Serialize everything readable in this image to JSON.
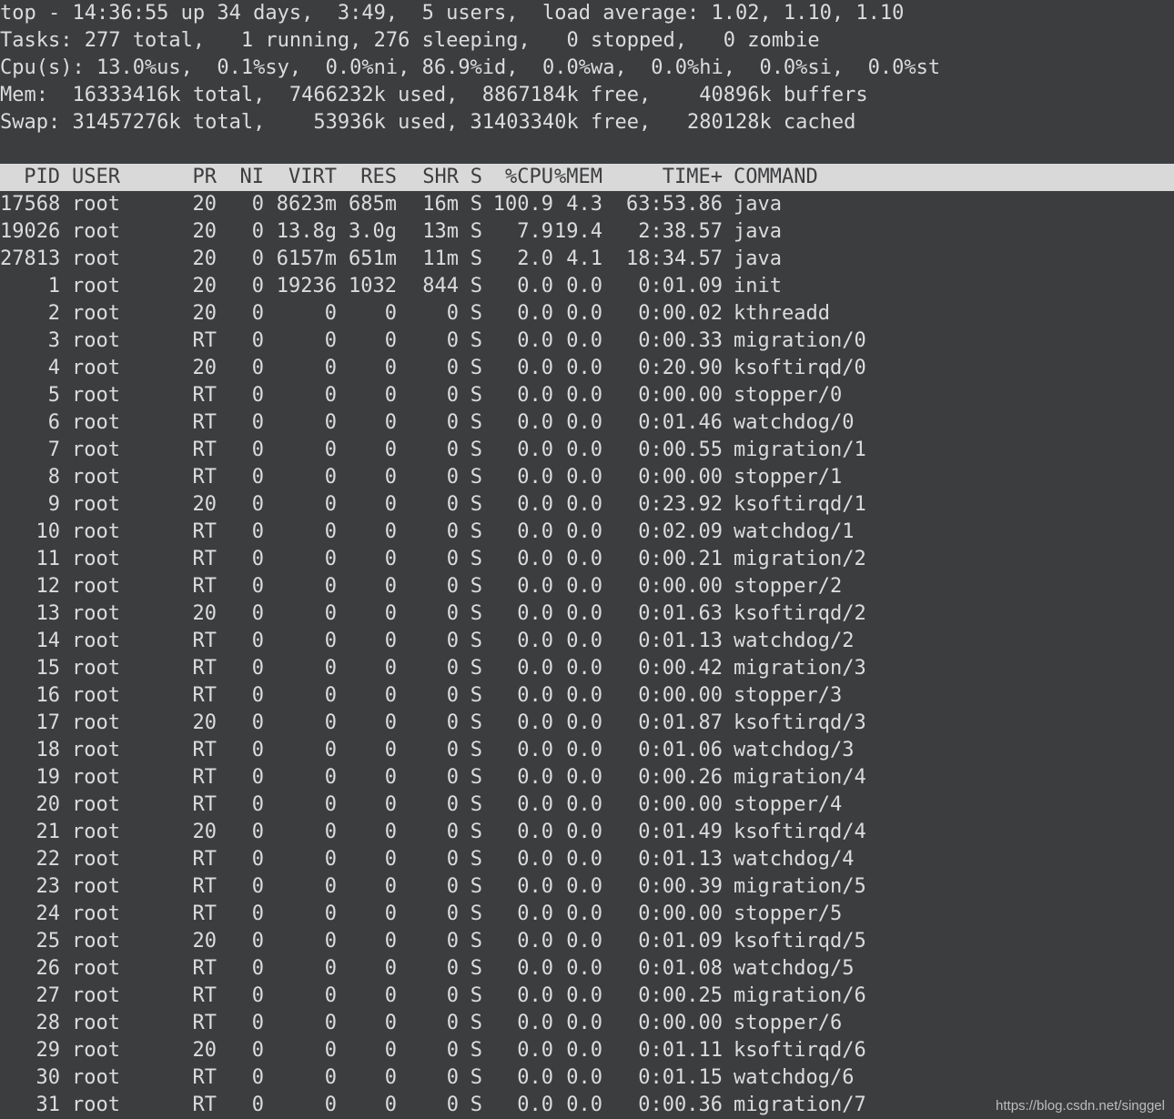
{
  "summary": {
    "line1": "top - 14:36:55 up 34 days,  3:49,  5 users,  load average: 1.02, 1.10, 1.10",
    "line2": "Tasks: 277 total,   1 running, 276 sleeping,   0 stopped,   0 zombie",
    "line3": "Cpu(s): 13.0%us,  0.1%sy,  0.0%ni, 86.9%id,  0.0%wa,  0.0%hi,  0.0%si,  0.0%st",
    "line4": "Mem:  16333416k total,  7466232k used,  8867184k free,    40896k buffers",
    "line5": "Swap: 31457276k total,    53936k used, 31403340k free,   280128k cached"
  },
  "columns": {
    "pid": "PID",
    "user": "USER",
    "pr": "PR",
    "ni": "NI",
    "virt": "VIRT",
    "res": "RES",
    "shr": "SHR",
    "s": "S",
    "cpu": "%CPU",
    "mem": "%MEM",
    "time": "TIME+",
    "command": "COMMAND"
  },
  "processes": [
    {
      "pid": "17568",
      "user": "root",
      "pr": "20",
      "ni": "0",
      "virt": "8623m",
      "res": "685m",
      "shr": "16m",
      "s": "S",
      "cpu": "100.9",
      "mem": "4.3",
      "time": "63:53.86",
      "command": "java"
    },
    {
      "pid": "19026",
      "user": "root",
      "pr": "20",
      "ni": "0",
      "virt": "13.8g",
      "res": "3.0g",
      "shr": "13m",
      "s": "S",
      "cpu": "7.9",
      "mem": "19.4",
      "time": "2:38.57",
      "command": "java"
    },
    {
      "pid": "27813",
      "user": "root",
      "pr": "20",
      "ni": "0",
      "virt": "6157m",
      "res": "651m",
      "shr": "11m",
      "s": "S",
      "cpu": "2.0",
      "mem": "4.1",
      "time": "18:34.57",
      "command": "java"
    },
    {
      "pid": "1",
      "user": "root",
      "pr": "20",
      "ni": "0",
      "virt": "19236",
      "res": "1032",
      "shr": "844",
      "s": "S",
      "cpu": "0.0",
      "mem": "0.0",
      "time": "0:01.09",
      "command": "init"
    },
    {
      "pid": "2",
      "user": "root",
      "pr": "20",
      "ni": "0",
      "virt": "0",
      "res": "0",
      "shr": "0",
      "s": "S",
      "cpu": "0.0",
      "mem": "0.0",
      "time": "0:00.02",
      "command": "kthreadd"
    },
    {
      "pid": "3",
      "user": "root",
      "pr": "RT",
      "ni": "0",
      "virt": "0",
      "res": "0",
      "shr": "0",
      "s": "S",
      "cpu": "0.0",
      "mem": "0.0",
      "time": "0:00.33",
      "command": "migration/0"
    },
    {
      "pid": "4",
      "user": "root",
      "pr": "20",
      "ni": "0",
      "virt": "0",
      "res": "0",
      "shr": "0",
      "s": "S",
      "cpu": "0.0",
      "mem": "0.0",
      "time": "0:20.90",
      "command": "ksoftirqd/0"
    },
    {
      "pid": "5",
      "user": "root",
      "pr": "RT",
      "ni": "0",
      "virt": "0",
      "res": "0",
      "shr": "0",
      "s": "S",
      "cpu": "0.0",
      "mem": "0.0",
      "time": "0:00.00",
      "command": "stopper/0"
    },
    {
      "pid": "6",
      "user": "root",
      "pr": "RT",
      "ni": "0",
      "virt": "0",
      "res": "0",
      "shr": "0",
      "s": "S",
      "cpu": "0.0",
      "mem": "0.0",
      "time": "0:01.46",
      "command": "watchdog/0"
    },
    {
      "pid": "7",
      "user": "root",
      "pr": "RT",
      "ni": "0",
      "virt": "0",
      "res": "0",
      "shr": "0",
      "s": "S",
      "cpu": "0.0",
      "mem": "0.0",
      "time": "0:00.55",
      "command": "migration/1"
    },
    {
      "pid": "8",
      "user": "root",
      "pr": "RT",
      "ni": "0",
      "virt": "0",
      "res": "0",
      "shr": "0",
      "s": "S",
      "cpu": "0.0",
      "mem": "0.0",
      "time": "0:00.00",
      "command": "stopper/1"
    },
    {
      "pid": "9",
      "user": "root",
      "pr": "20",
      "ni": "0",
      "virt": "0",
      "res": "0",
      "shr": "0",
      "s": "S",
      "cpu": "0.0",
      "mem": "0.0",
      "time": "0:23.92",
      "command": "ksoftirqd/1"
    },
    {
      "pid": "10",
      "user": "root",
      "pr": "RT",
      "ni": "0",
      "virt": "0",
      "res": "0",
      "shr": "0",
      "s": "S",
      "cpu": "0.0",
      "mem": "0.0",
      "time": "0:02.09",
      "command": "watchdog/1"
    },
    {
      "pid": "11",
      "user": "root",
      "pr": "RT",
      "ni": "0",
      "virt": "0",
      "res": "0",
      "shr": "0",
      "s": "S",
      "cpu": "0.0",
      "mem": "0.0",
      "time": "0:00.21",
      "command": "migration/2"
    },
    {
      "pid": "12",
      "user": "root",
      "pr": "RT",
      "ni": "0",
      "virt": "0",
      "res": "0",
      "shr": "0",
      "s": "S",
      "cpu": "0.0",
      "mem": "0.0",
      "time": "0:00.00",
      "command": "stopper/2"
    },
    {
      "pid": "13",
      "user": "root",
      "pr": "20",
      "ni": "0",
      "virt": "0",
      "res": "0",
      "shr": "0",
      "s": "S",
      "cpu": "0.0",
      "mem": "0.0",
      "time": "0:01.63",
      "command": "ksoftirqd/2"
    },
    {
      "pid": "14",
      "user": "root",
      "pr": "RT",
      "ni": "0",
      "virt": "0",
      "res": "0",
      "shr": "0",
      "s": "S",
      "cpu": "0.0",
      "mem": "0.0",
      "time": "0:01.13",
      "command": "watchdog/2"
    },
    {
      "pid": "15",
      "user": "root",
      "pr": "RT",
      "ni": "0",
      "virt": "0",
      "res": "0",
      "shr": "0",
      "s": "S",
      "cpu": "0.0",
      "mem": "0.0",
      "time": "0:00.42",
      "command": "migration/3"
    },
    {
      "pid": "16",
      "user": "root",
      "pr": "RT",
      "ni": "0",
      "virt": "0",
      "res": "0",
      "shr": "0",
      "s": "S",
      "cpu": "0.0",
      "mem": "0.0",
      "time": "0:00.00",
      "command": "stopper/3"
    },
    {
      "pid": "17",
      "user": "root",
      "pr": "20",
      "ni": "0",
      "virt": "0",
      "res": "0",
      "shr": "0",
      "s": "S",
      "cpu": "0.0",
      "mem": "0.0",
      "time": "0:01.87",
      "command": "ksoftirqd/3"
    },
    {
      "pid": "18",
      "user": "root",
      "pr": "RT",
      "ni": "0",
      "virt": "0",
      "res": "0",
      "shr": "0",
      "s": "S",
      "cpu": "0.0",
      "mem": "0.0",
      "time": "0:01.06",
      "command": "watchdog/3"
    },
    {
      "pid": "19",
      "user": "root",
      "pr": "RT",
      "ni": "0",
      "virt": "0",
      "res": "0",
      "shr": "0",
      "s": "S",
      "cpu": "0.0",
      "mem": "0.0",
      "time": "0:00.26",
      "command": "migration/4"
    },
    {
      "pid": "20",
      "user": "root",
      "pr": "RT",
      "ni": "0",
      "virt": "0",
      "res": "0",
      "shr": "0",
      "s": "S",
      "cpu": "0.0",
      "mem": "0.0",
      "time": "0:00.00",
      "command": "stopper/4"
    },
    {
      "pid": "21",
      "user": "root",
      "pr": "20",
      "ni": "0",
      "virt": "0",
      "res": "0",
      "shr": "0",
      "s": "S",
      "cpu": "0.0",
      "mem": "0.0",
      "time": "0:01.49",
      "command": "ksoftirqd/4"
    },
    {
      "pid": "22",
      "user": "root",
      "pr": "RT",
      "ni": "0",
      "virt": "0",
      "res": "0",
      "shr": "0",
      "s": "S",
      "cpu": "0.0",
      "mem": "0.0",
      "time": "0:01.13",
      "command": "watchdog/4"
    },
    {
      "pid": "23",
      "user": "root",
      "pr": "RT",
      "ni": "0",
      "virt": "0",
      "res": "0",
      "shr": "0",
      "s": "S",
      "cpu": "0.0",
      "mem": "0.0",
      "time": "0:00.39",
      "command": "migration/5"
    },
    {
      "pid": "24",
      "user": "root",
      "pr": "RT",
      "ni": "0",
      "virt": "0",
      "res": "0",
      "shr": "0",
      "s": "S",
      "cpu": "0.0",
      "mem": "0.0",
      "time": "0:00.00",
      "command": "stopper/5"
    },
    {
      "pid": "25",
      "user": "root",
      "pr": "20",
      "ni": "0",
      "virt": "0",
      "res": "0",
      "shr": "0",
      "s": "S",
      "cpu": "0.0",
      "mem": "0.0",
      "time": "0:01.09",
      "command": "ksoftirqd/5"
    },
    {
      "pid": "26",
      "user": "root",
      "pr": "RT",
      "ni": "0",
      "virt": "0",
      "res": "0",
      "shr": "0",
      "s": "S",
      "cpu": "0.0",
      "mem": "0.0",
      "time": "0:01.08",
      "command": "watchdog/5"
    },
    {
      "pid": "27",
      "user": "root",
      "pr": "RT",
      "ni": "0",
      "virt": "0",
      "res": "0",
      "shr": "0",
      "s": "S",
      "cpu": "0.0",
      "mem": "0.0",
      "time": "0:00.25",
      "command": "migration/6"
    },
    {
      "pid": "28",
      "user": "root",
      "pr": "RT",
      "ni": "0",
      "virt": "0",
      "res": "0",
      "shr": "0",
      "s": "S",
      "cpu": "0.0",
      "mem": "0.0",
      "time": "0:00.00",
      "command": "stopper/6"
    },
    {
      "pid": "29",
      "user": "root",
      "pr": "20",
      "ni": "0",
      "virt": "0",
      "res": "0",
      "shr": "0",
      "s": "S",
      "cpu": "0.0",
      "mem": "0.0",
      "time": "0:01.11",
      "command": "ksoftirqd/6"
    },
    {
      "pid": "30",
      "user": "root",
      "pr": "RT",
      "ni": "0",
      "virt": "0",
      "res": "0",
      "shr": "0",
      "s": "S",
      "cpu": "0.0",
      "mem": "0.0",
      "time": "0:01.15",
      "command": "watchdog/6"
    },
    {
      "pid": "31",
      "user": "root",
      "pr": "RT",
      "ni": "0",
      "virt": "0",
      "res": "0",
      "shr": "0",
      "s": "S",
      "cpu": "0.0",
      "mem": "0.0",
      "time": "0:00.36",
      "command": "migration/7"
    }
  ],
  "watermark": "https://blog.csdn.net/singgel",
  "colors": {
    "background": "#3c3d3f",
    "foreground": "#dcdcdc",
    "header_background": "#d9d9d9",
    "header_foreground": "#3c3d3f"
  }
}
